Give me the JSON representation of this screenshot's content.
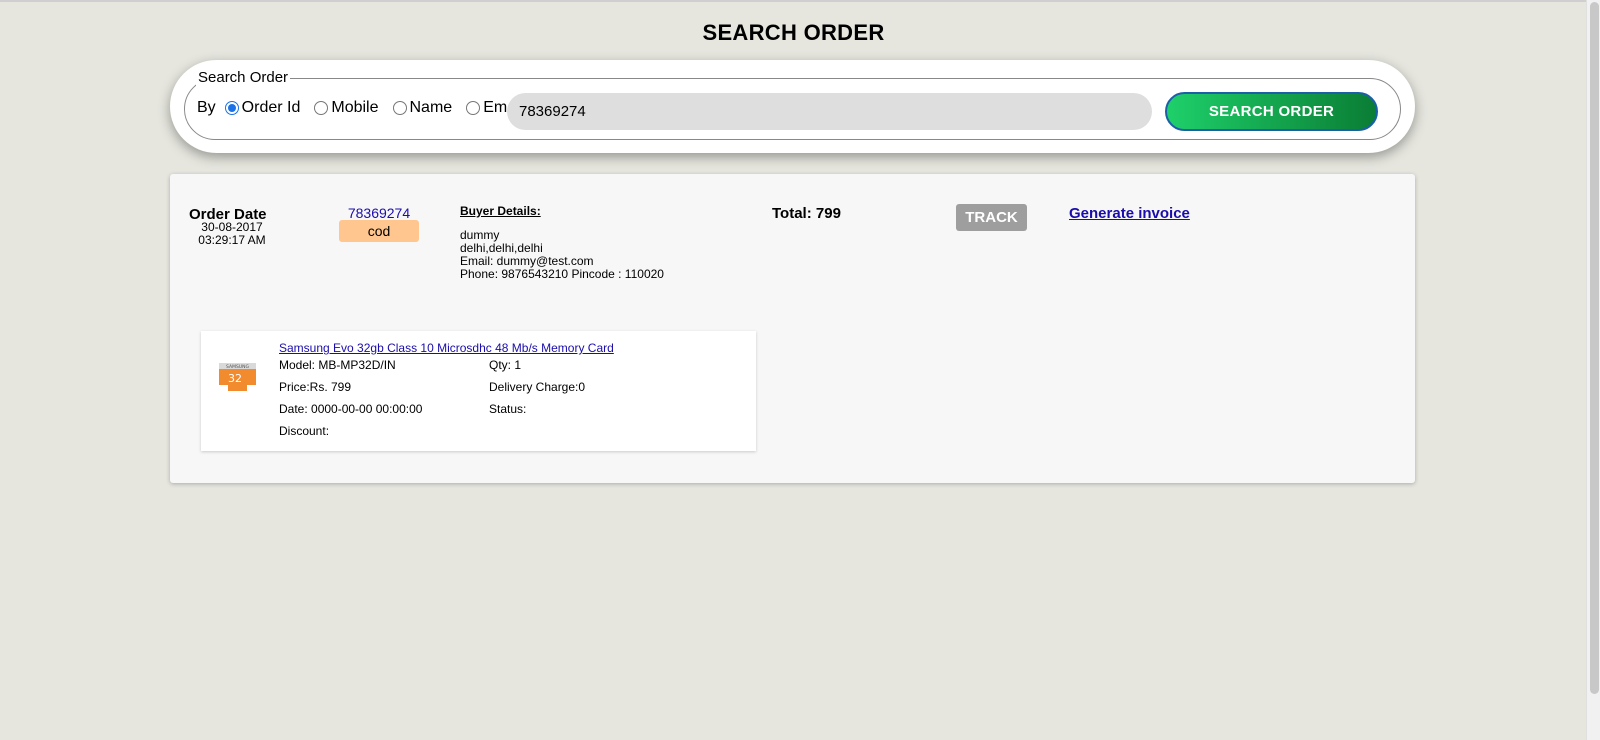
{
  "page": {
    "title": "SEARCH ORDER"
  },
  "search": {
    "legend": "Search Order",
    "by_label": "By",
    "options": [
      {
        "label": "Order Id",
        "selected": true
      },
      {
        "label": "Mobile",
        "selected": false
      },
      {
        "label": "Name",
        "selected": false
      },
      {
        "label": "Email",
        "selected": false
      }
    ],
    "value": "78369274",
    "button_label": "SEARCH ORDER"
  },
  "order": {
    "date_label": "Order Date",
    "date": "30-08-2017",
    "time": "03:29:17 AM",
    "id": "78369274",
    "payment": "cod",
    "buyer_title": "Buyer Details:",
    "buyer_name": "dummy",
    "buyer_address": "delhi,delhi,delhi",
    "buyer_email": "Email: dummy@test.com",
    "buyer_phone": "Phone: 9876543210 Pincode : 110020",
    "total": "Total: 799",
    "track_label": "TRACK",
    "invoice_label": "Generate invoice"
  },
  "product": {
    "name": "Samsung Evo 32gb Class 10 Microsdhc 48 Mb/s Memory Card",
    "model": "Model: MB-MP32D/IN",
    "qty": "Qty: 1",
    "price": "Price:Rs. 799",
    "delivery": "Delivery Charge:0",
    "date": "Date: 0000-00-00 00:00:00",
    "status": "Status:",
    "discount": "Discount:",
    "thumb_brand": "SAMSUNG",
    "thumb_capacity": "32"
  },
  "colors": {
    "search_button_start": "#1ed06a",
    "search_button_end": "#0a7d34",
    "payment_badge": "#ffc78f",
    "track_button": "#9e9e9e",
    "link": "#1a0dab"
  }
}
